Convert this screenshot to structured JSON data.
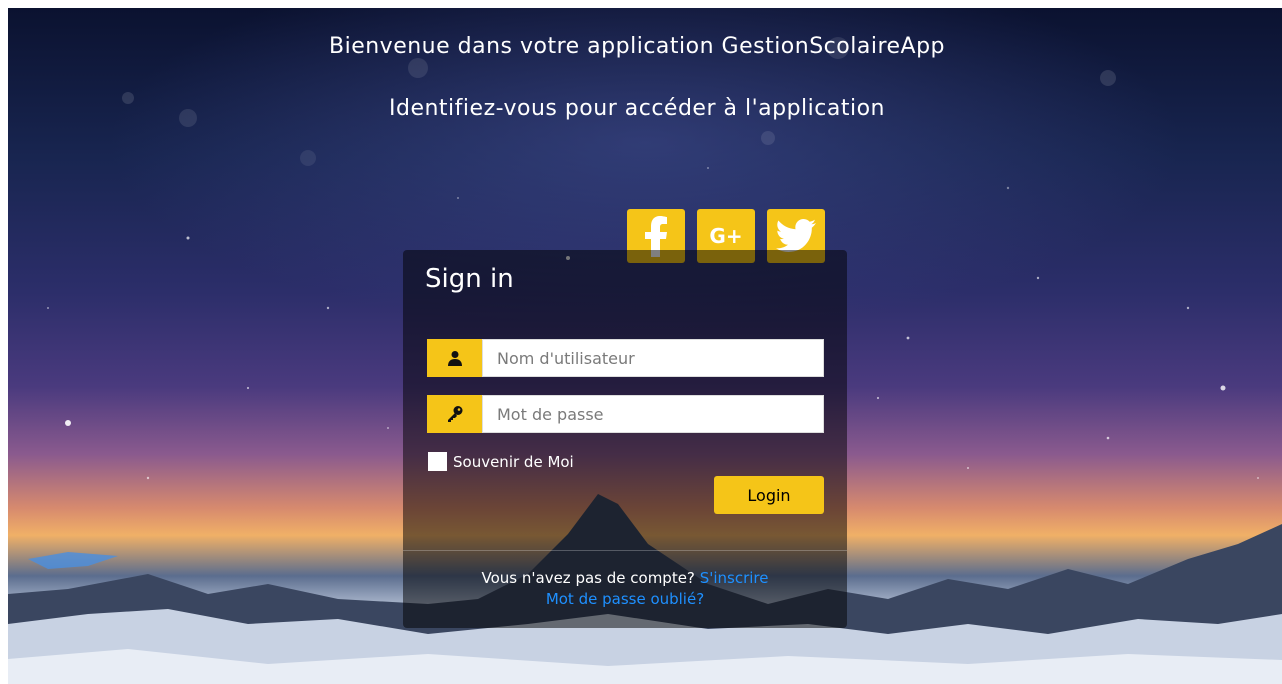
{
  "header": {
    "welcome": "Bienvenue dans votre application GestionScolaireApp",
    "subtitle": "Identifiez-vous pour accéder à l'application"
  },
  "social": {
    "facebook_icon": "facebook-icon",
    "google_label": "G+",
    "twitter_icon": "twitter-icon"
  },
  "form": {
    "title": "Sign in",
    "username_placeholder": "Nom d'utilisateur",
    "username_value": "",
    "password_placeholder": "Mot de passe",
    "password_value": "",
    "remember_label": "Souvenir de Moi",
    "login_label": "Login"
  },
  "footer": {
    "no_account_text": "Vous n'avez pas de compte?",
    "signup_link": "S'inscrire",
    "forgot_link": "Mot de passe oublié?"
  },
  "colors": {
    "accent": "#f5c518",
    "link": "#1e90ff"
  }
}
